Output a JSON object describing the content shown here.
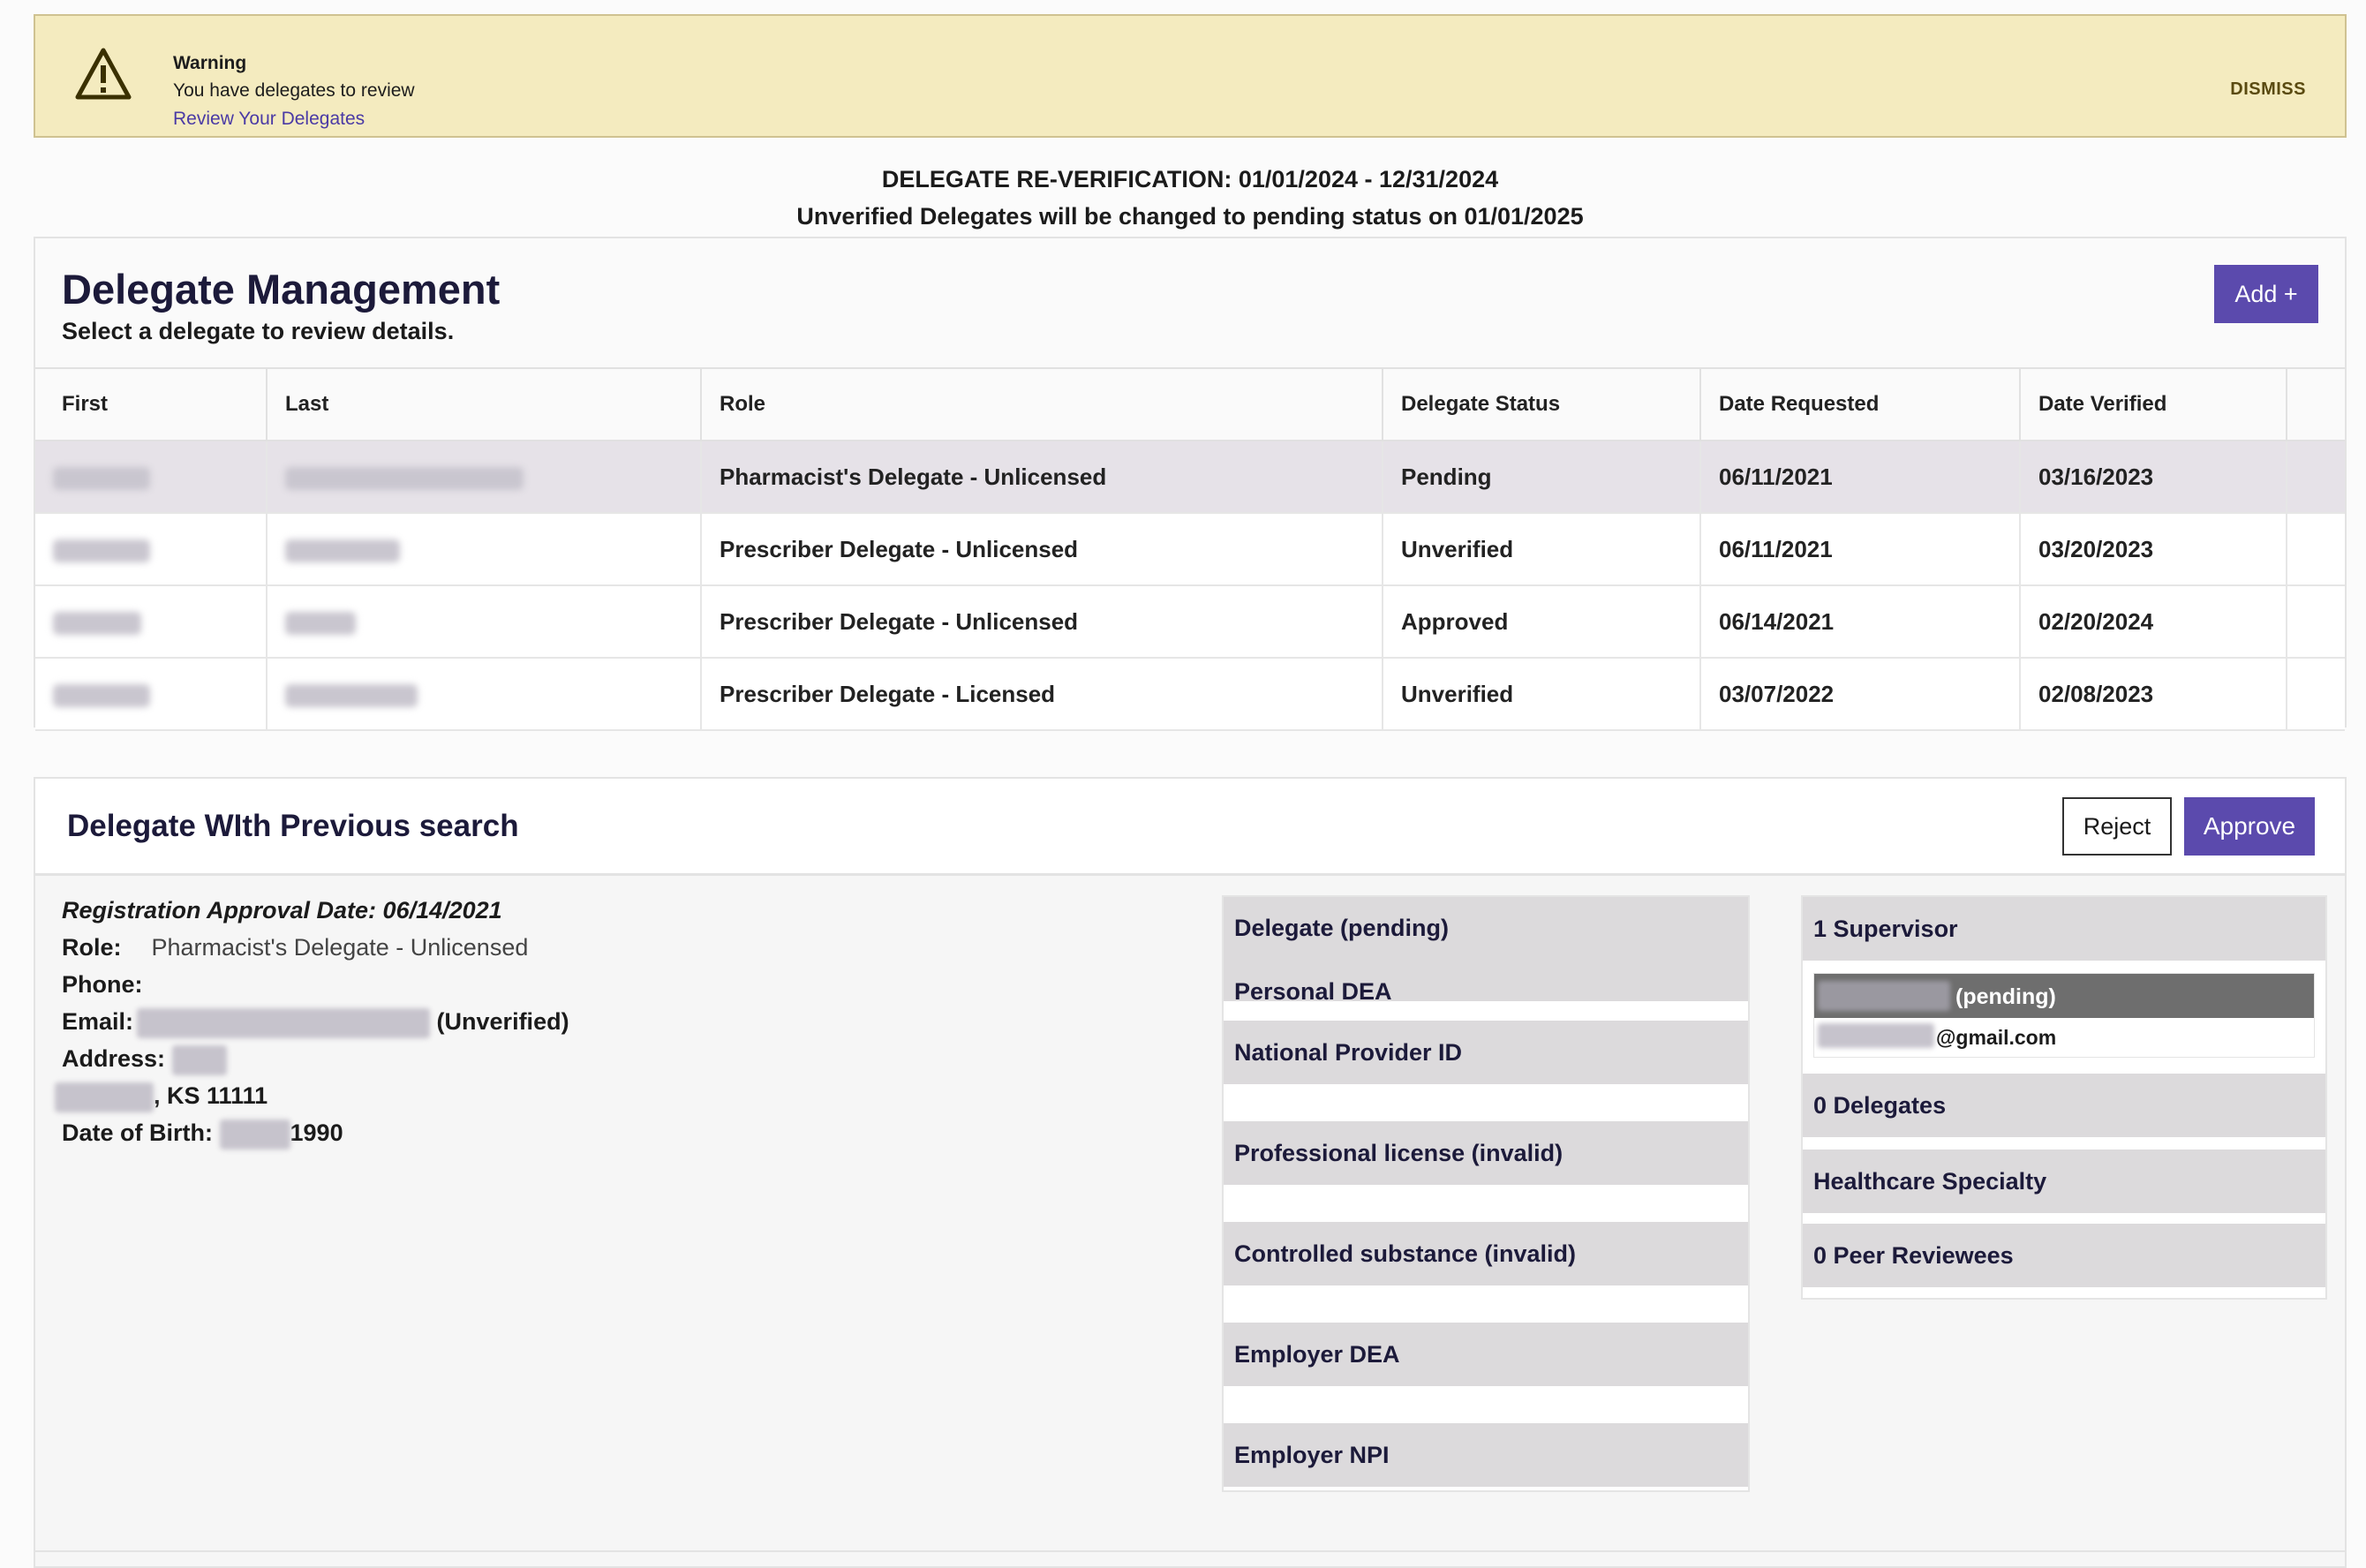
{
  "alert": {
    "title": "Warning",
    "message": "You have delegates to review",
    "link": "Review Your Delegates",
    "dismiss": "DISMISS",
    "icon": "warning-triangle-icon"
  },
  "notice": {
    "line1": "DELEGATE RE-VERIFICATION: 01/01/2024 - 12/31/2024",
    "line2": "Unverified Delegates will be changed to pending status on 01/01/2025"
  },
  "management": {
    "title": "Delegate Management",
    "subtitle": "Select a delegate to review details.",
    "add_label": "Add +",
    "columns": [
      "First",
      "Last",
      "Role",
      "Delegate Status",
      "Date Requested",
      "Date Verified"
    ],
    "rows": [
      {
        "role": "Pharmacist's Delegate - Unlicensed",
        "status": "Pending",
        "requested": "06/11/2021",
        "verified": "03/16/2023"
      },
      {
        "role": "Prescriber Delegate - Unlicensed",
        "status": "Unverified",
        "requested": "06/11/2021",
        "verified": "03/20/2023"
      },
      {
        "role": "Prescriber Delegate - Unlicensed",
        "status": "Approved",
        "requested": "06/14/2021",
        "verified": "02/20/2024"
      },
      {
        "role": "Prescriber Delegate - Licensed",
        "status": "Unverified",
        "requested": "03/07/2022",
        "verified": "02/08/2023"
      }
    ]
  },
  "detail": {
    "title": "Delegate WIth Previous search",
    "reject_label": "Reject",
    "approve_label": "Approve",
    "registration": "Registration Approval Date: 06/14/2021",
    "role_label": "Role:",
    "role_value": "Pharmacist's Delegate - Unlicensed",
    "phone_label": "Phone:",
    "email_label": "Email:",
    "email_status": "(Unverified)",
    "address_label": "Address:",
    "city_suffix": ", KS 11111",
    "dob_label": "Date of Birth:",
    "dob_year": "1990",
    "sections": [
      "Delegate (pending)",
      "Personal DEA",
      "National Provider ID",
      "Professional license (invalid)",
      "Controlled substance (invalid)",
      "Employer DEA",
      "Employer NPI"
    ],
    "right": {
      "supervisor_header": "1 Supervisor",
      "supervisor_status": "(pending)",
      "supervisor_email_domain": "@gmail.com",
      "delegates": "0 Delegates",
      "specialty": "Healthcare Specialty",
      "peer_reviewees": "0 Peer Reviewees"
    }
  }
}
